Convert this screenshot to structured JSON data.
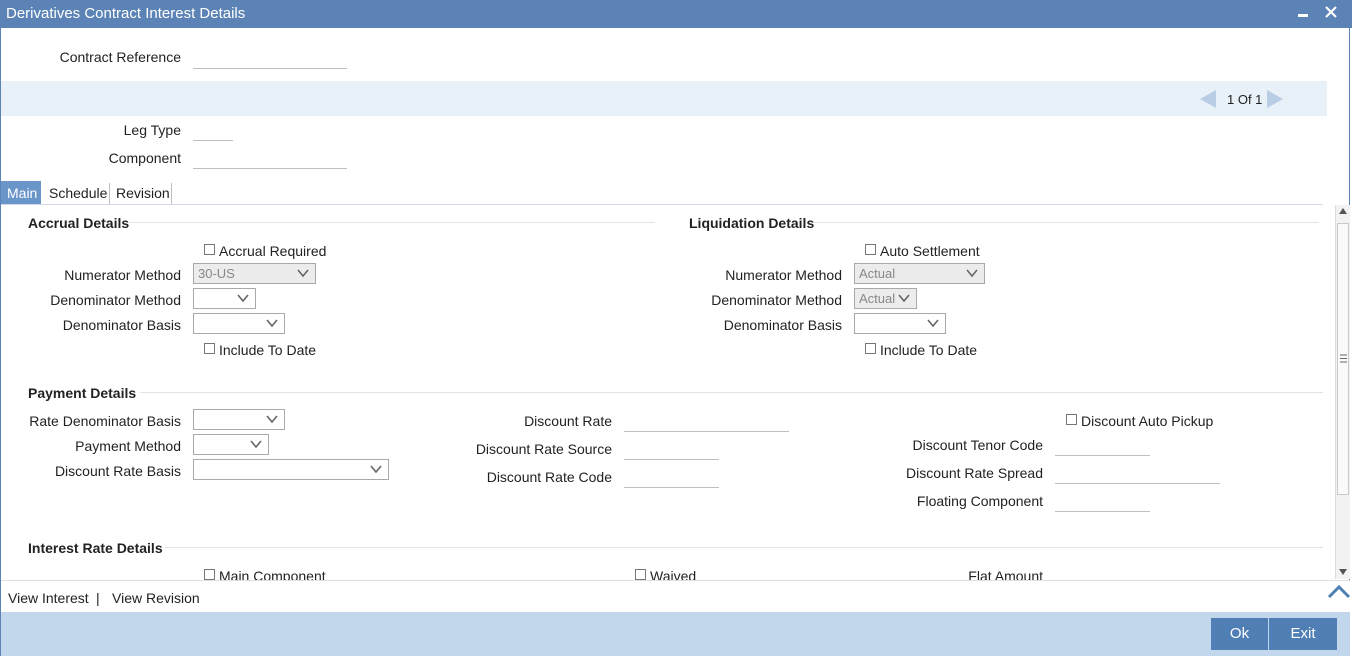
{
  "window": {
    "title": "Derivatives Contract Interest Details"
  },
  "header": {
    "contract_reference_label": "Contract Reference",
    "contract_reference_value": ""
  },
  "pager": {
    "text": "1 Of 1"
  },
  "leg": {
    "leg_type_label": "Leg Type",
    "component_label": "Component"
  },
  "tabs": [
    {
      "label": "Main"
    },
    {
      "label": "Schedule"
    },
    {
      "label": "Revision"
    }
  ],
  "accrual": {
    "title": "Accrual Details",
    "accrual_required": "Accrual Required",
    "numerator_method_label": "Numerator Method",
    "numerator_method_value": "30-US",
    "denominator_method_label": "Denominator Method",
    "denominator_basis_label": "Denominator Basis",
    "include_to_date": "Include To Date"
  },
  "liquidation": {
    "title": "Liquidation Details",
    "auto_settlement": "Auto Settlement",
    "numerator_method_label": "Numerator Method",
    "numerator_method_value": "Actual",
    "denominator_method_label": "Denominator Method",
    "denominator_method_value": "Actual",
    "denominator_basis_label": "Denominator Basis",
    "include_to_date": "Include To Date"
  },
  "payment": {
    "title": "Payment Details",
    "rate_denominator_basis_label": "Rate Denominator Basis",
    "payment_method_label": "Payment Method",
    "discount_rate_basis_label": "Discount Rate Basis",
    "discount_rate_label": "Discount Rate",
    "discount_rate_source_label": "Discount Rate Source",
    "discount_rate_code_label": "Discount Rate Code",
    "discount_auto_pickup": "Discount Auto Pickup",
    "discount_tenor_code_label": "Discount Tenor Code",
    "discount_rate_spread_label": "Discount Rate Spread",
    "floating_component_label": "Floating Component"
  },
  "interest_rate": {
    "title": "Interest Rate Details",
    "main_component": "Main Component",
    "waived": "Waived",
    "flat_amount_label": "Flat Amount"
  },
  "footer": {
    "view_interest": "View Interest",
    "separator": "|",
    "view_revision": "View Revision"
  },
  "buttons": {
    "ok": "Ok",
    "exit": "Exit"
  },
  "colors": {
    "title_bar": "#5b83b5",
    "button": "#4f7fb5",
    "footer": "#c2d6ec"
  }
}
